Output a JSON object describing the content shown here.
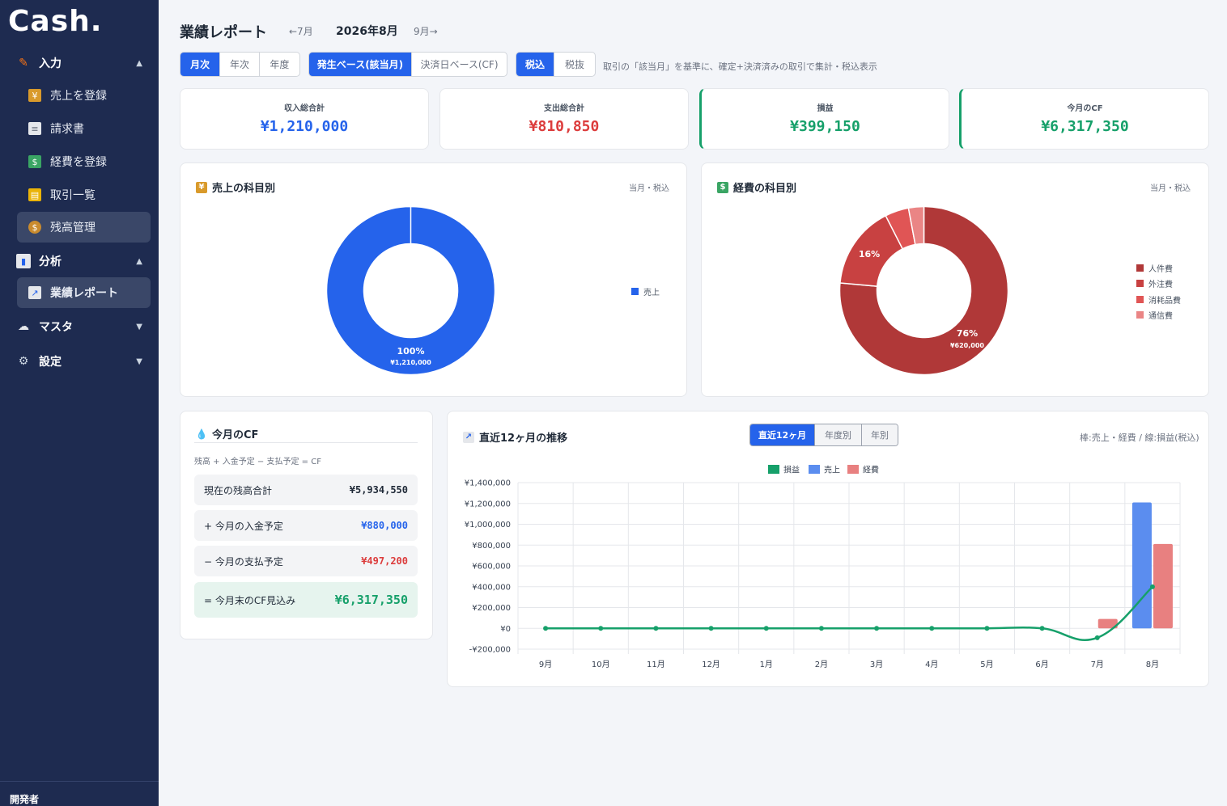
{
  "app": {
    "logo": "Cash."
  },
  "sidebar": {
    "groups": {
      "input": "入力",
      "analysis": "分析",
      "master": "マスタ",
      "settings": "設定"
    },
    "items": {
      "sales": "売上を登録",
      "invoice": "請求書",
      "expense": "経費を登録",
      "transactions": "取引一覧",
      "balance": "残高管理",
      "report": "業績レポート"
    },
    "footer": "開発者"
  },
  "header": {
    "title": "業績レポート",
    "prev": "←7月",
    "current": "2026年8月",
    "next": "9月→"
  },
  "filters": {
    "period": [
      "月次",
      "年次",
      "年度"
    ],
    "basis": [
      "発生ベース(該当月)",
      "決済日ベース(CF)"
    ],
    "tax": [
      "税込",
      "税抜"
    ],
    "hint": "取引の「該当月」を基準に、確定+決済済みの取引で集計・税込表示"
  },
  "kpis": {
    "income": {
      "label": "収入総合計",
      "value": "¥1,210,000"
    },
    "expense": {
      "label": "支出総合計",
      "value": "¥810,850"
    },
    "profit": {
      "label": "損益",
      "value": "¥399,150"
    },
    "cf": {
      "label": "今月のCF",
      "value": "¥6,317,350"
    }
  },
  "sales_card": {
    "title": "売上の科目別",
    "note": "当月・税込",
    "pct_label": "100%",
    "amt_label": "¥1,210,000"
  },
  "expense_card": {
    "title": "経費の科目別",
    "note": "当月・税込",
    "big_pct": "76%",
    "big_amt": "¥620,000",
    "small_pct": "16%"
  },
  "cf_card": {
    "title": "今月のCF",
    "formula": "残高 + 入金予定 − 支払予定 = CF",
    "rows": {
      "balance": {
        "label": "現在の残高合計",
        "value": "¥5,934,550"
      },
      "in": {
        "label": "+ 今月の入金予定",
        "value": "¥880,000"
      },
      "out": {
        "label": "− 今月の支払予定",
        "value": "¥497,200"
      },
      "total": {
        "label": "= 今月末のCF見込み",
        "value": "¥6,317,350"
      }
    }
  },
  "trend_card": {
    "title": "直近12ヶ月の推移",
    "tabs": [
      "直近12ヶ月",
      "年度別",
      "年別"
    ],
    "note": "棒:売上・経費 / 線:損益(税込)"
  },
  "colors": {
    "blue": "#2563eb",
    "red": "#dc3c3c",
    "green": "#16a06a",
    "sidebar": "#1e2b50"
  },
  "chart_data": [
    {
      "type": "pie",
      "title": "売上の科目別",
      "labels": [
        "売上"
      ],
      "values": [
        1210000
      ],
      "colors": [
        "#2563eb"
      ]
    },
    {
      "type": "pie",
      "title": "経費の科目別",
      "labels": [
        "人件費",
        "外注費",
        "消耗品費",
        "通信費"
      ],
      "values": [
        620000,
        130000,
        37000,
        23850
      ],
      "colors": [
        "#b03838",
        "#c84141",
        "#e05555",
        "#ea8585"
      ]
    },
    {
      "type": "bar",
      "title": "直近12ヶ月の推移",
      "categories": [
        "9月",
        "10月",
        "11月",
        "12月",
        "1月",
        "2月",
        "3月",
        "4月",
        "5月",
        "6月",
        "7月",
        "8月"
      ],
      "series": [
        {
          "name": "損益",
          "type": "line",
          "color": "#16a06a",
          "values": [
            0,
            0,
            0,
            0,
            0,
            0,
            0,
            0,
            0,
            0,
            -90000,
            399150
          ]
        },
        {
          "name": "売上",
          "type": "bar",
          "color": "#5b8def",
          "values": [
            0,
            0,
            0,
            0,
            0,
            0,
            0,
            0,
            0,
            0,
            0,
            1210000
          ]
        },
        {
          "name": "経費",
          "type": "bar",
          "color": "#e88080",
          "values": [
            0,
            0,
            0,
            0,
            0,
            0,
            0,
            0,
            0,
            0,
            90000,
            810850
          ]
        }
      ],
      "ylim": [
        -200000,
        1400000
      ],
      "yticks": [
        "¥1,400,000",
        "¥1,200,000",
        "¥1,000,000",
        "¥800,000",
        "¥600,000",
        "¥400,000",
        "¥200,000",
        "¥0",
        "-¥200,000"
      ],
      "ytick_values": [
        1400000,
        1200000,
        1000000,
        800000,
        600000,
        400000,
        200000,
        0,
        -200000
      ],
      "legend": "top",
      "grid": true
    }
  ]
}
